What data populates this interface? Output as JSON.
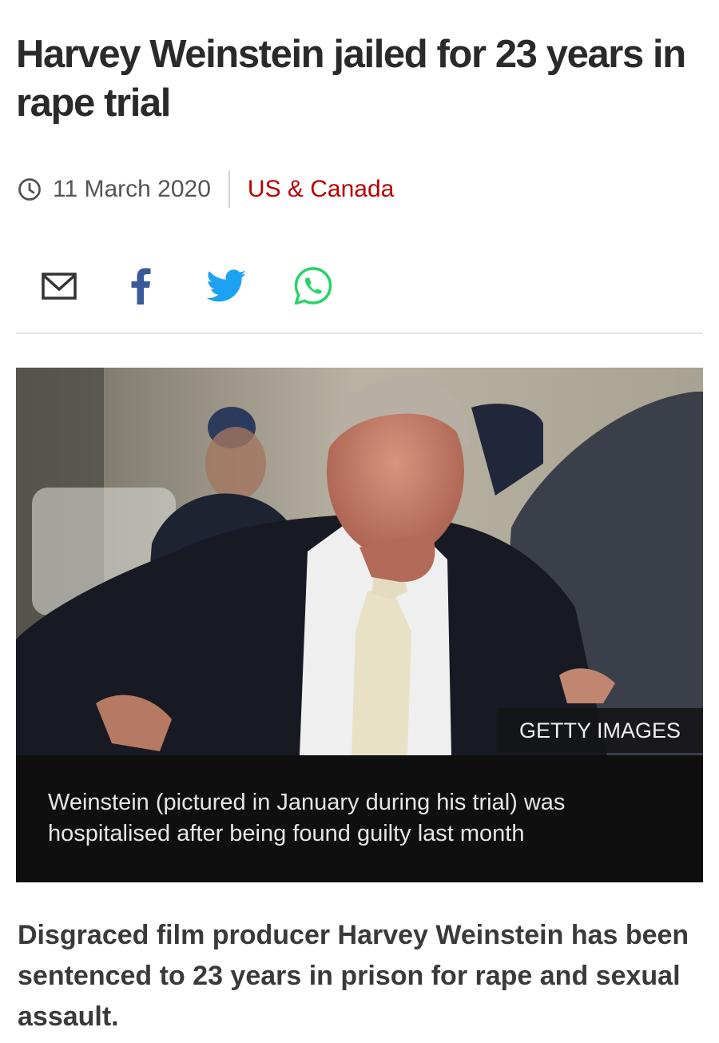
{
  "article": {
    "headline": "Harvey Weinstein jailed for 23 years in rape trial",
    "date": "11 March 2020",
    "section": "US & Canada",
    "lede": "Disgraced film producer Harvey Weinstein has been sentenced to 23 years in prison for rape and sexual assault."
  },
  "share": {
    "icons": [
      "email-icon",
      "facebook-icon",
      "twitter-icon",
      "whatsapp-icon"
    ]
  },
  "image": {
    "credit": "GETTY IMAGES",
    "caption": "Weinstein (pictured in January during his trial) was hospitalised after being found guilty last month"
  },
  "colors": {
    "section_link": "#b80000",
    "facebook": "#3b5998",
    "twitter": "#1da1f2",
    "whatsapp": "#25d366"
  }
}
